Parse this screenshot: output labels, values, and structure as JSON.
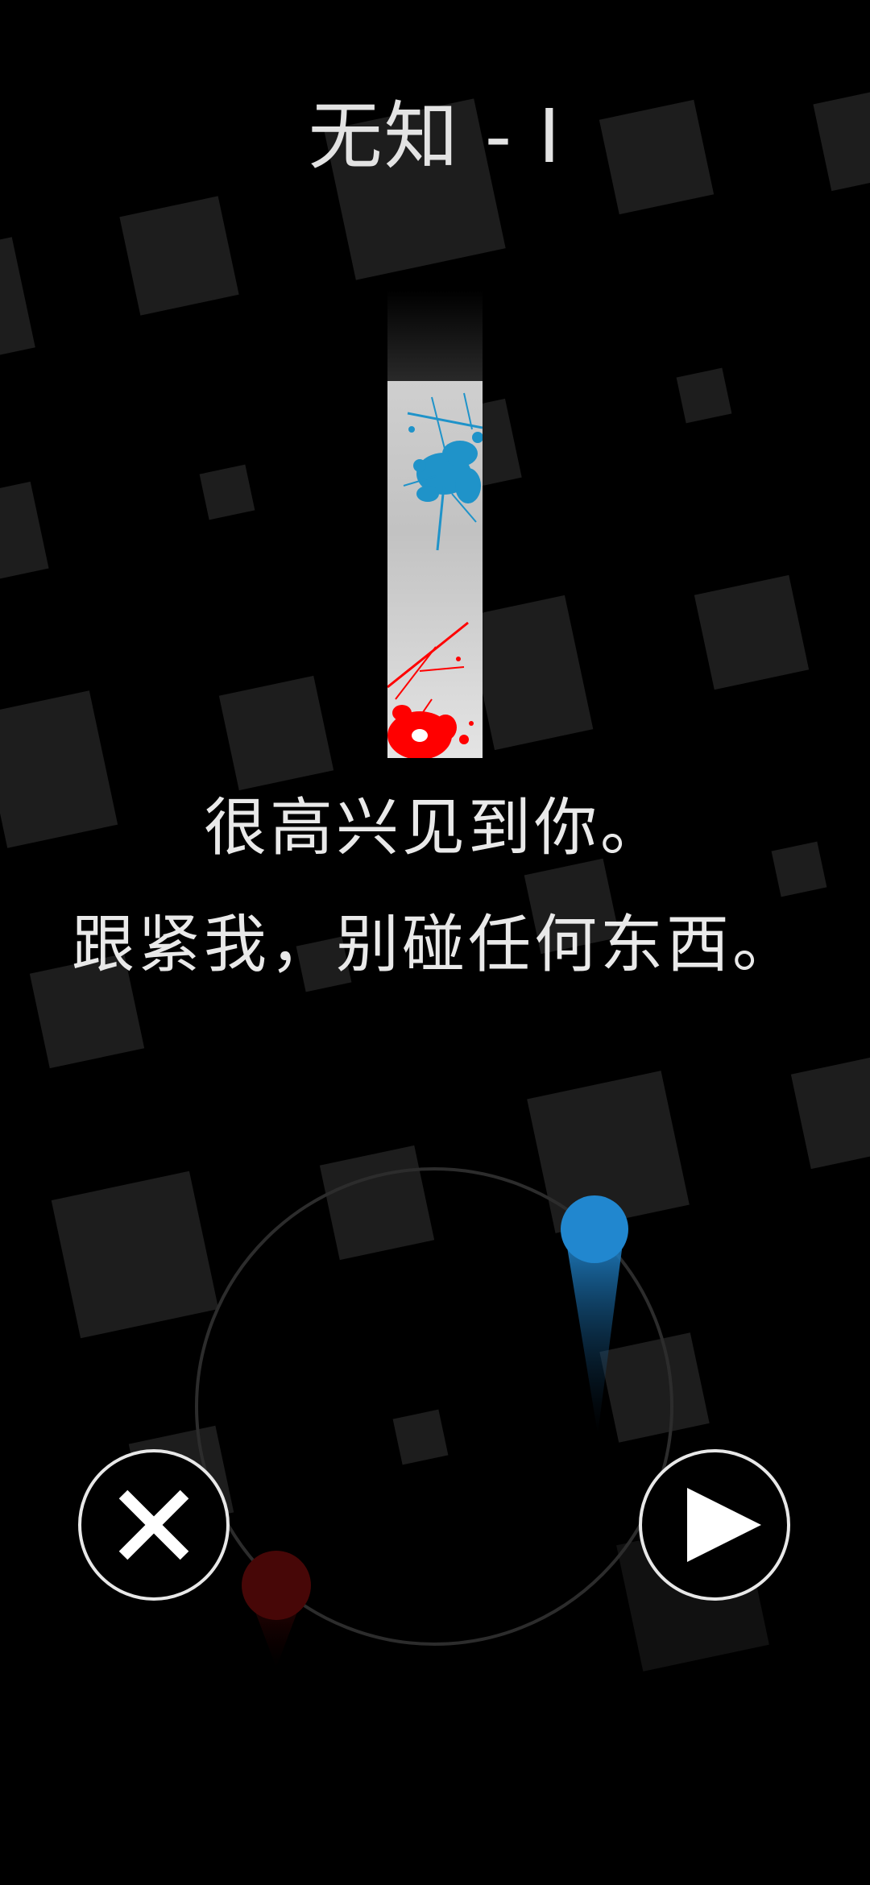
{
  "level": {
    "title": "无知 - I"
  },
  "dialog": {
    "line1": "很高兴见到你。",
    "line2": "跟紧我，别碰任何东西。"
  },
  "controls": {
    "close_icon": "close-x-icon",
    "play_icon": "play-triangle-icon"
  },
  "colors": {
    "background": "#000000",
    "player_ball": "#2187cf",
    "enemy_ball": "#470707",
    "bar_splatter_blue": "#1f93c9",
    "bar_splatter_red": "#ff0000"
  }
}
